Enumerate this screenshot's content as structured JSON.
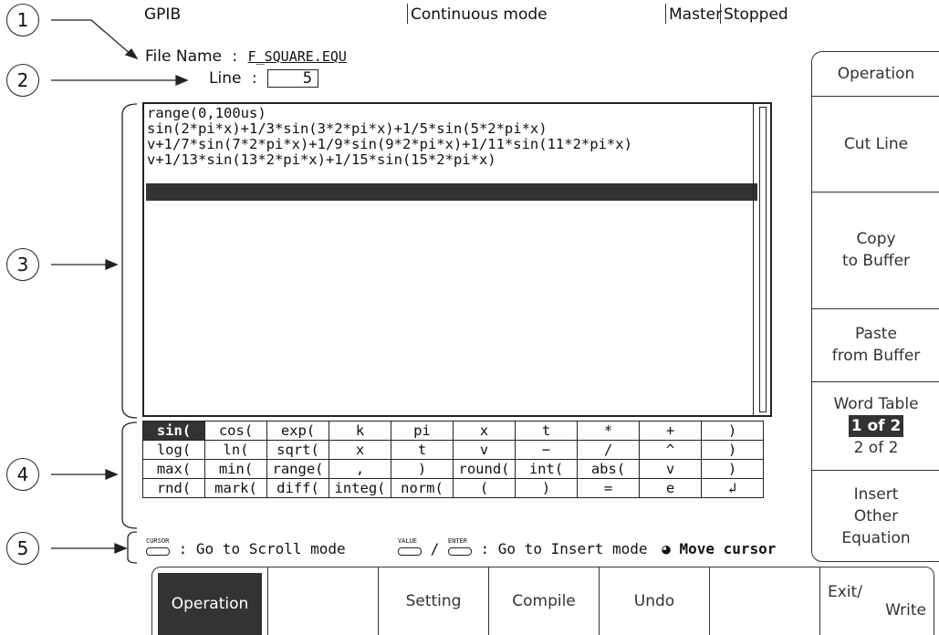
{
  "status": {
    "interface": "GPIB",
    "mode": "Continuous mode",
    "role": "Master",
    "state": "Stopped"
  },
  "callouts": [
    "1",
    "2",
    "3",
    "4",
    "5"
  ],
  "file": {
    "name_label": "File Name",
    "name_value": "F_SQUARE.EQU",
    "line_label": "Line",
    "line_value": "5",
    "colon": ":"
  },
  "editor": {
    "lines": [
      "range(0,100us)",
      "sin(2*pi*x)+1/3*sin(3*2*pi*x)+1/5*sin(5*2*pi*x)",
      "v+1/7*sin(7*2*pi*x)+1/9*sin(9*2*pi*x)+1/11*sin(11*2*pi*x)",
      "v+1/13*sin(13*2*pi*x)+1/15*sin(15*2*pi*x)",
      ""
    ],
    "cursor_line": 5
  },
  "word_table": {
    "rows": [
      [
        "sin(",
        "cos(",
        "exp(",
        "k",
        "pi",
        "x",
        "t",
        "*",
        "+",
        ")"
      ],
      [
        "log(",
        "ln(",
        "sqrt(",
        "x",
        "t",
        "v",
        "−",
        "/",
        "^",
        ")"
      ],
      [
        "max(",
        "min(",
        "range(",
        ",",
        ")",
        "round(",
        "int(",
        "abs(",
        "v",
        ")"
      ],
      [
        "rnd(",
        "mark(",
        "diff(",
        "integ(",
        "norm(",
        "(",
        ")",
        "=",
        "e",
        "↲"
      ]
    ],
    "selected": "sin("
  },
  "hint": {
    "cursor_key": "CURSOR",
    "cursor_text": ": Go to Scroll mode",
    "value_key": "VALUE",
    "slash": "/",
    "enter_key": "ENTER",
    "insert_text": ": Go to Insert mode",
    "knob_text": "Move cursor"
  },
  "side_menu": {
    "title": "Operation",
    "cut_line": "Cut Line",
    "copy_1": "Copy",
    "copy_2": "to Buffer",
    "paste_1": "Paste",
    "paste_2": "from Buffer",
    "word_table": "Word Table",
    "page_1": "1 of 2",
    "page_2": "2 of 2",
    "insert_1": "Insert",
    "insert_2": "Other",
    "insert_3": "Equation"
  },
  "bottom_menu": {
    "operation": "Operation",
    "setting": "Setting",
    "compile": "Compile",
    "undo": "Undo",
    "exit_1": "Exit/",
    "exit_2": "Write"
  }
}
